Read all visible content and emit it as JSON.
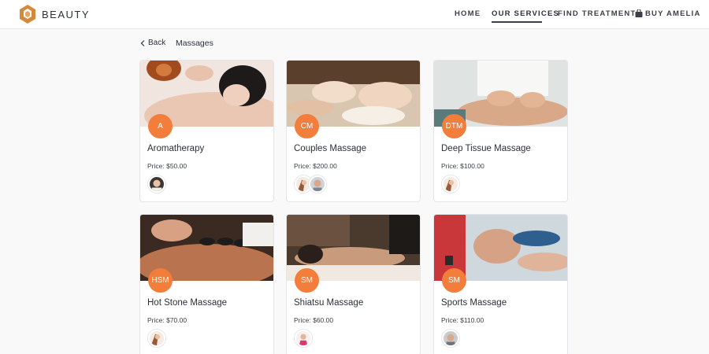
{
  "header": {
    "brand": "BEAUTY",
    "nav": [
      {
        "label": "HOME"
      },
      {
        "label": "OUR SERVICES",
        "active": true
      },
      {
        "label": "FIND TREATMENT"
      },
      {
        "label": "BUY AMELIA"
      }
    ]
  },
  "breadcrumb": {
    "back_label": "Back",
    "title": "Massages"
  },
  "colors": {
    "accent": "#f37d3b",
    "text": "#2c3038",
    "logo": "#d5893a"
  },
  "services": [
    {
      "initials": "A",
      "name": "Aromatherapy",
      "price": "Price: $50.00",
      "employees": 1
    },
    {
      "initials": "CM",
      "name": "Couples Massage",
      "price": "Price: $200.00",
      "employees": 2
    },
    {
      "initials": "DTM",
      "name": "Deep Tissue Massage",
      "price": "Price: $100.00",
      "employees": 1
    },
    {
      "initials": "HSM",
      "name": "Hot Stone Massage",
      "price": "Price: $70.00",
      "employees": 1
    },
    {
      "initials": "SM",
      "name": "Shiatsu Massage",
      "price": "Price: $60.00",
      "employees": 1
    },
    {
      "initials": "SM",
      "name": "Sports Massage",
      "price": "Price: $110.00",
      "employees": 1
    }
  ]
}
